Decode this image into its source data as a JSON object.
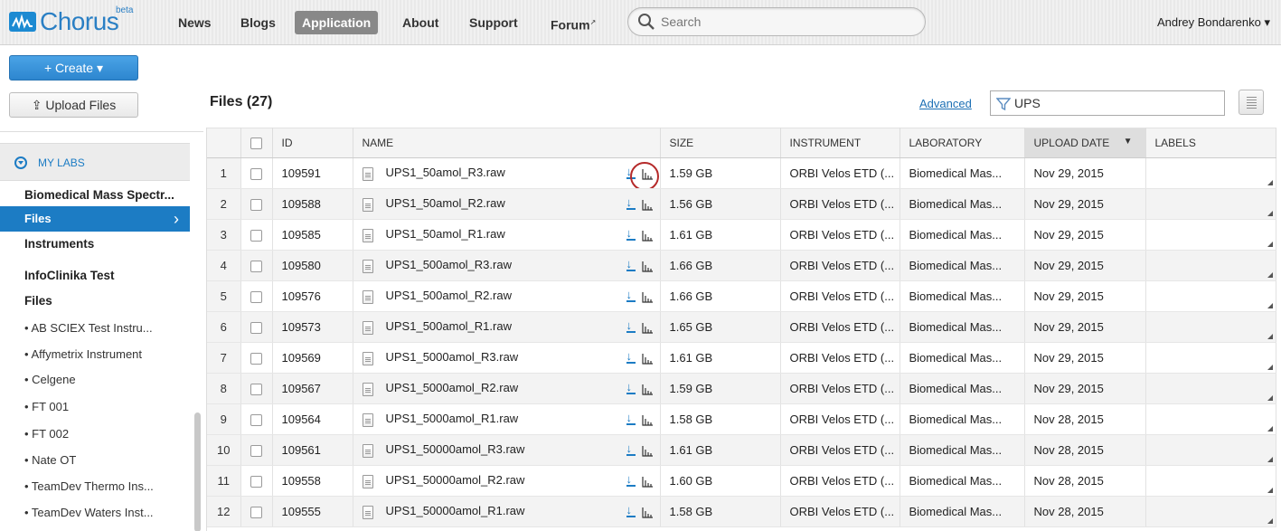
{
  "brand": {
    "name": "Chorus",
    "badge": "beta"
  },
  "nav": [
    {
      "label": "News",
      "active": false
    },
    {
      "label": "Blogs",
      "active": false
    },
    {
      "label": "Application",
      "active": true
    },
    {
      "label": "About",
      "active": false
    },
    {
      "label": "Support",
      "active": false
    },
    {
      "label": "Forum",
      "active": false
    }
  ],
  "search": {
    "placeholder": "Search"
  },
  "user": {
    "name": "Andrey Bondarenko ▾"
  },
  "actions": {
    "create_label": "+ Create ▾",
    "upload_label": "⇪ Upload Files"
  },
  "sidebar": {
    "section_label": "MY LABS",
    "items": [
      {
        "label": "Biomedical Mass Spectr...",
        "style": "bold"
      },
      {
        "label": "Files",
        "style": "active"
      },
      {
        "label": "Instruments",
        "style": "plain-bold"
      },
      {
        "label": "InfoClinika Test",
        "style": "bold"
      },
      {
        "label": "Files",
        "style": "plain-bold"
      },
      {
        "label": "• AB SCIEX Test Instru...",
        "style": "small"
      },
      {
        "label": "• Affymetrix Instrument",
        "style": "small"
      },
      {
        "label": "• Celgene",
        "style": "small"
      },
      {
        "label": "• FT 001",
        "style": "small"
      },
      {
        "label": "• FT 002",
        "style": "small"
      },
      {
        "label": "• Nate OT",
        "style": "small"
      },
      {
        "label": "• TeamDev Thermo Ins...",
        "style": "small"
      },
      {
        "label": "• TeamDev Waters Inst...",
        "style": "small"
      }
    ]
  },
  "files": {
    "title": "Files (27)",
    "advanced_label": "Advanced",
    "filter_value": "UPS"
  },
  "table": {
    "columns": [
      "ID",
      "NAME",
      "SIZE",
      "INSTRUMENT",
      "LABORATORY",
      "UPLOAD DATE",
      "LABELS"
    ],
    "sort_indicator": "▼",
    "rows": [
      {
        "n": "1",
        "id": "109591",
        "name": "UPS1_50amol_R3.raw",
        "size": "1.59 GB",
        "instrument": "ORBI Velos ETD (...",
        "lab": "Biomedical Mas...",
        "date": "Nov 29, 2015"
      },
      {
        "n": "2",
        "id": "109588",
        "name": "UPS1_50amol_R2.raw",
        "size": "1.56 GB",
        "instrument": "ORBI Velos ETD (...",
        "lab": "Biomedical Mas...",
        "date": "Nov 29, 2015"
      },
      {
        "n": "3",
        "id": "109585",
        "name": "UPS1_50amol_R1.raw",
        "size": "1.61 GB",
        "instrument": "ORBI Velos ETD (...",
        "lab": "Biomedical Mas...",
        "date": "Nov 29, 2015"
      },
      {
        "n": "4",
        "id": "109580",
        "name": "UPS1_500amol_R3.raw",
        "size": "1.66 GB",
        "instrument": "ORBI Velos ETD (...",
        "lab": "Biomedical Mas...",
        "date": "Nov 29, 2015"
      },
      {
        "n": "5",
        "id": "109576",
        "name": "UPS1_500amol_R2.raw",
        "size": "1.66 GB",
        "instrument": "ORBI Velos ETD (...",
        "lab": "Biomedical Mas...",
        "date": "Nov 29, 2015"
      },
      {
        "n": "6",
        "id": "109573",
        "name": "UPS1_500amol_R1.raw",
        "size": "1.65 GB",
        "instrument": "ORBI Velos ETD (...",
        "lab": "Biomedical Mas...",
        "date": "Nov 29, 2015"
      },
      {
        "n": "7",
        "id": "109569",
        "name": "UPS1_5000amol_R3.raw",
        "size": "1.61 GB",
        "instrument": "ORBI Velos ETD (...",
        "lab": "Biomedical Mas...",
        "date": "Nov 29, 2015"
      },
      {
        "n": "8",
        "id": "109567",
        "name": "UPS1_5000amol_R2.raw",
        "size": "1.59 GB",
        "instrument": "ORBI Velos ETD (...",
        "lab": "Biomedical Mas...",
        "date": "Nov 29, 2015"
      },
      {
        "n": "9",
        "id": "109564",
        "name": "UPS1_5000amol_R1.raw",
        "size": "1.58 GB",
        "instrument": "ORBI Velos ETD (...",
        "lab": "Biomedical Mas...",
        "date": "Nov 28, 2015"
      },
      {
        "n": "10",
        "id": "109561",
        "name": "UPS1_50000amol_R3.raw",
        "size": "1.61 GB",
        "instrument": "ORBI Velos ETD (...",
        "lab": "Biomedical Mas...",
        "date": "Nov 28, 2015"
      },
      {
        "n": "11",
        "id": "109558",
        "name": "UPS1_50000amol_R2.raw",
        "size": "1.60 GB",
        "instrument": "ORBI Velos ETD (...",
        "lab": "Biomedical Mas...",
        "date": "Nov 28, 2015"
      },
      {
        "n": "12",
        "id": "109555",
        "name": "UPS1_50000amol_R1.raw",
        "size": "1.58 GB",
        "instrument": "ORBI Velos ETD (...",
        "lab": "Biomedical Mas...",
        "date": "Nov 28, 2015"
      }
    ]
  },
  "colors": {
    "accent": "#1c7cc4",
    "highlight_ring": "#b52a2a"
  }
}
